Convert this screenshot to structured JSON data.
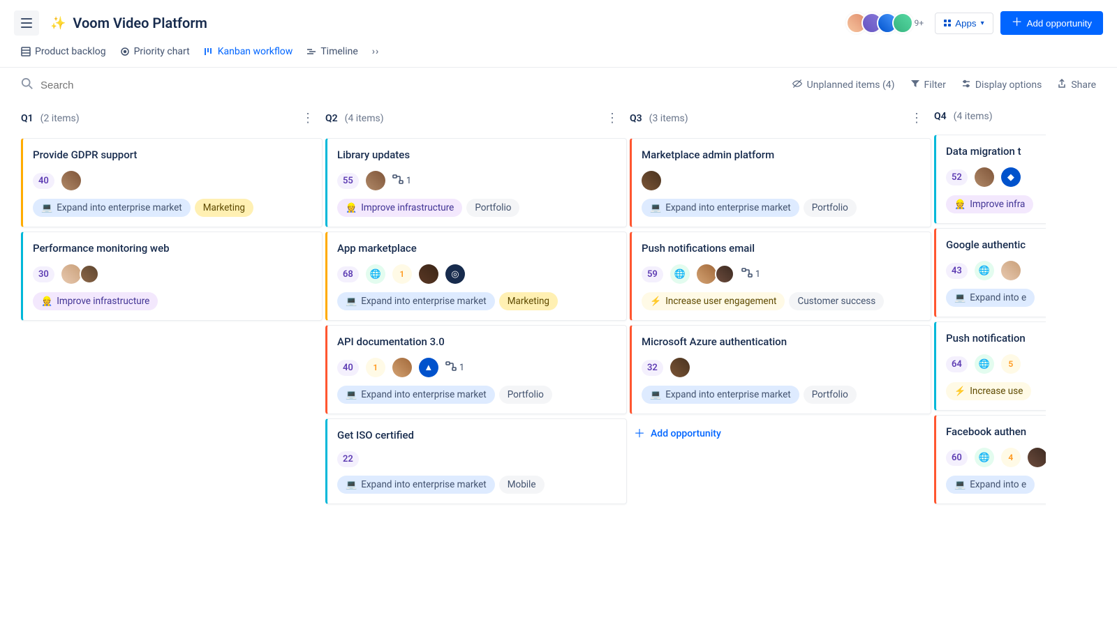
{
  "header": {
    "title": "Voom Video Platform",
    "sparkle": "✨",
    "avatars_overflow": "9+",
    "apps_label": "Apps",
    "add_button": "Add opportunity"
  },
  "tabs": {
    "backlog": "Product backlog",
    "priority": "Priority chart",
    "kanban": "Kanban workflow",
    "timeline": "Timeline"
  },
  "toolbar": {
    "search_placeholder": "Search",
    "unplanned": "Unplanned items (4)",
    "filter": "Filter",
    "display": "Display options",
    "share": "Share"
  },
  "columns": {
    "q1": {
      "title": "Q1",
      "count": "(2 items)"
    },
    "q2": {
      "title": "Q2",
      "count": "(4 items)"
    },
    "q3": {
      "title": "Q3",
      "count": "(3 items)"
    },
    "q4": {
      "title": "Q4",
      "count": "(4 items)"
    }
  },
  "add_link": "Add opportunity",
  "tags_text": {
    "enterprise": "Expand into enterprise market",
    "marketing": "Marketing",
    "infra": "Improve infrastructure",
    "portfolio": "Portfolio",
    "mobile": "Mobile",
    "engagement": "Increase user engagement",
    "customer": "Customer success",
    "enterprise_cut": "Expand into e",
    "infra_cut": "Improve infra",
    "engage_cut": "Increase use"
  },
  "cards": {
    "gdpr": {
      "title": "Provide GDPR support",
      "score": "40"
    },
    "perf": {
      "title": "Performance monitoring web",
      "score": "30"
    },
    "lib": {
      "title": "Library updates",
      "score": "55",
      "children": "1"
    },
    "appm": {
      "title": "App marketplace",
      "score": "68",
      "badge": "1"
    },
    "api": {
      "title": "API documentation 3.0",
      "score": "40",
      "badge": "1",
      "children": "1"
    },
    "iso": {
      "title": "Get ISO certified",
      "score": "22"
    },
    "mkt": {
      "title": "Marketplace admin platform"
    },
    "push": {
      "title": "Push notifications email",
      "score": "59",
      "children": "1"
    },
    "azure": {
      "title": "Microsoft Azure authentication",
      "score": "32"
    },
    "data": {
      "title": "Data migration t",
      "score": "52"
    },
    "goog": {
      "title": "Google authentic",
      "score": "43"
    },
    "pushm": {
      "title": "Push notification",
      "score": "64",
      "badge": "5"
    },
    "fb": {
      "title": "Facebook authen",
      "score": "60",
      "badge": "4"
    }
  }
}
